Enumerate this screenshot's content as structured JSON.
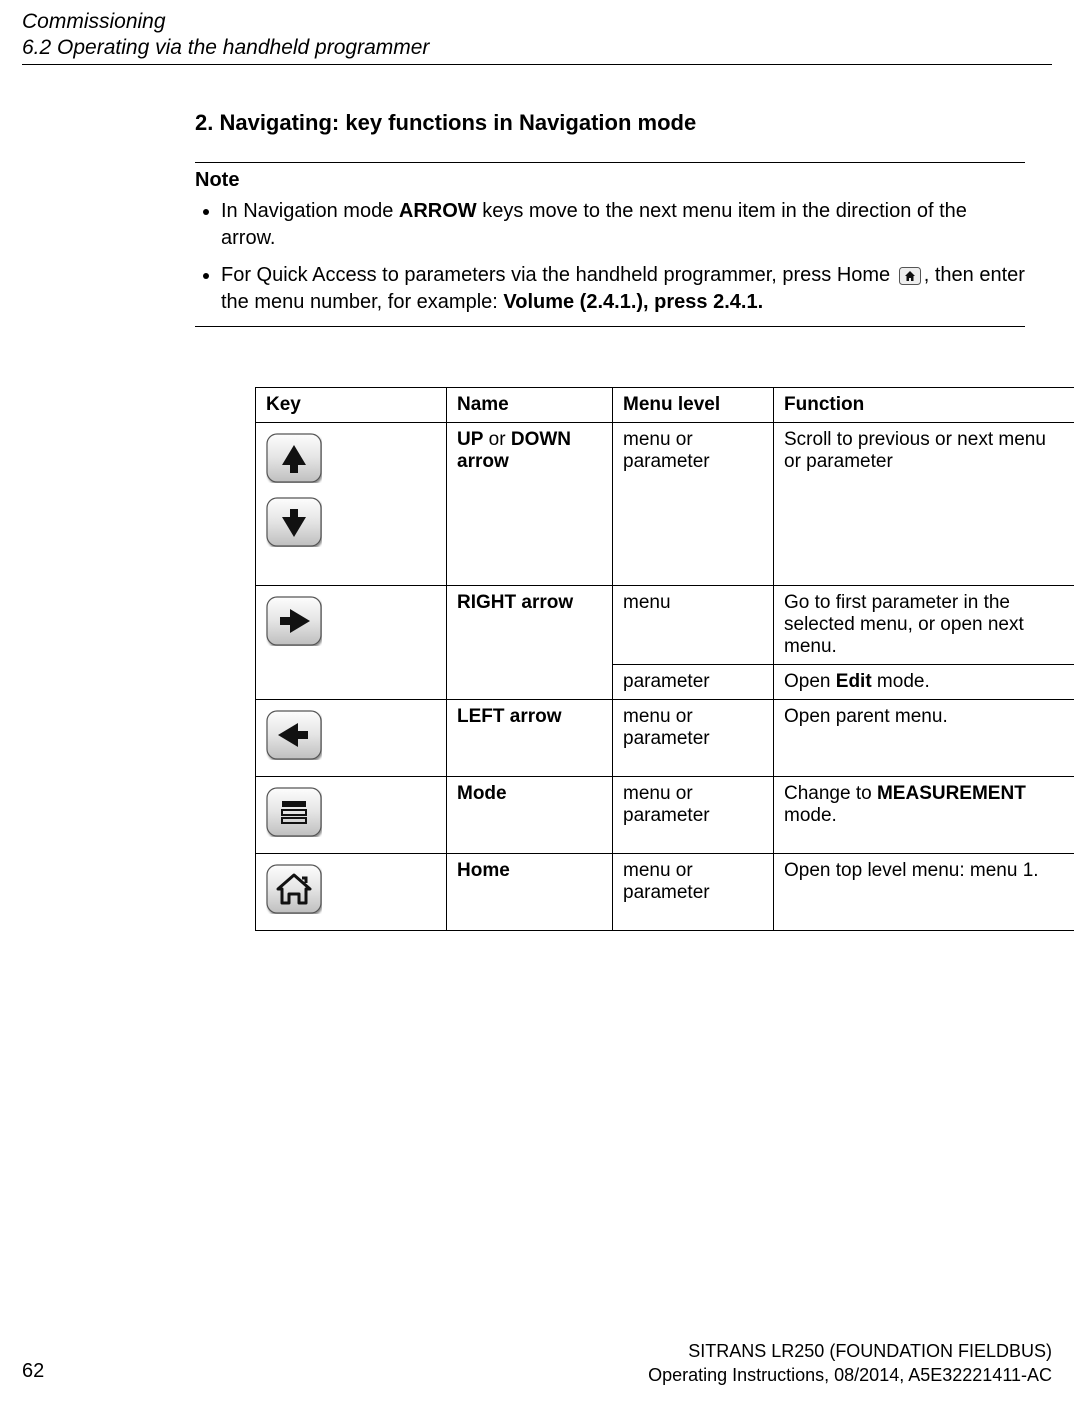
{
  "header": {
    "chapter": "Commissioning",
    "section": "6.2 Operating via the handheld programmer"
  },
  "heading": "2. Navigating: key functions in Navigation mode",
  "note": {
    "label": "Note",
    "b1_pre": "In Navigation mode ",
    "b1_bold": "ARROW",
    "b1_post": " keys move to the next menu item in the direction of the arrow.",
    "b2_pre": "For Quick Access to parameters via the handheld programmer, press Home ",
    "b2_mid": ", then enter the menu number, for example: ",
    "b2_bold": "Volume (2.4.1.), press 2.4.1."
  },
  "table": {
    "h_key": "Key",
    "h_name": "Name",
    "h_menu": "Menu level",
    "h_func": "Function",
    "r1_name_pre": "UP",
    "r1_name_mid": " or ",
    "r1_name_post": "DOWN arrow",
    "r1_menu": "menu or parameter",
    "r1_func": "Scroll to previous or next menu or parameter",
    "r2_name": "RIGHT arrow",
    "r2_menu": "menu",
    "r2_func": "Go to first parameter in the selected menu, or open next menu.",
    "r2b_menu": "parameter",
    "r2b_func_pre": "Open ",
    "r2b_func_bold": "Edit",
    "r2b_func_post": " mode.",
    "r3_name": "LEFT arrow",
    "r3_menu": "menu or parameter",
    "r3_func": "Open parent menu.",
    "r4_name": "Mode",
    "r4_menu": "menu or parameter",
    "r4_func_pre": "Change to ",
    "r4_func_bold": "MEASUREMENT",
    "r4_func_post": " mode.",
    "r5_name": "Home",
    "r5_menu": "menu or parameter",
    "r5_func": "Open top level menu: menu 1."
  },
  "footer": {
    "product": "SITRANS LR250 (FOUNDATION FIELDBUS)",
    "docline": "Operating Instructions, 08/2014, A5E32221411-AC",
    "page": "62"
  }
}
